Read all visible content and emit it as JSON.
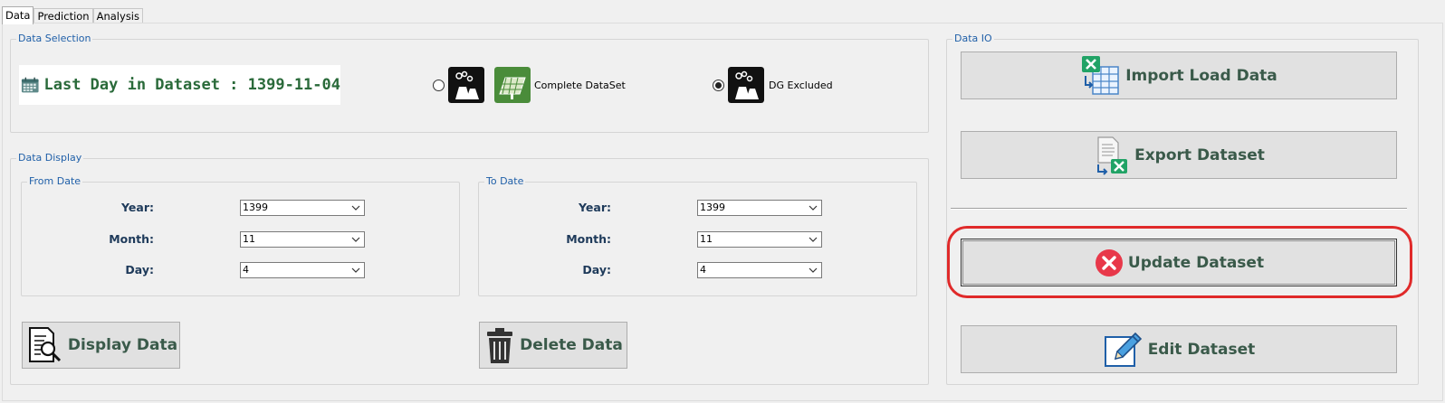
{
  "tabs": [
    {
      "label": "Data"
    },
    {
      "label": "Prediction"
    },
    {
      "label": "Analysis"
    }
  ],
  "data_selection": {
    "title": "Data Selection",
    "last_day_text": "Last Day in Dataset : 1399-11-04",
    "options": [
      {
        "label": "Complete DataSet",
        "selected": false
      },
      {
        "label": "DG Excluded",
        "selected": true
      }
    ]
  },
  "data_display": {
    "title": "Data Display",
    "from": {
      "title": "From Date",
      "year_label": "Year:",
      "year_value": "1399",
      "month_label": "Month:",
      "month_value": "11",
      "day_label": "Day:",
      "day_value": "4"
    },
    "to": {
      "title": "To Date",
      "year_label": "Year:",
      "year_value": "1399",
      "month_label": "Month:",
      "month_value": "11",
      "day_label": "Day:",
      "day_value": "4"
    },
    "display_button": "Display Data",
    "delete_button": "Delete Data"
  },
  "data_io": {
    "title": "Data IO",
    "import_button": "Import Load Data",
    "export_button": "Export Dataset",
    "update_button": "Update Dataset",
    "edit_button": "Edit Dataset"
  },
  "colors": {
    "accent_text": "#2a6a3a",
    "group_title": "#1f5fa8",
    "highlight": "#e02a2a",
    "excel_green": "#21a366"
  }
}
